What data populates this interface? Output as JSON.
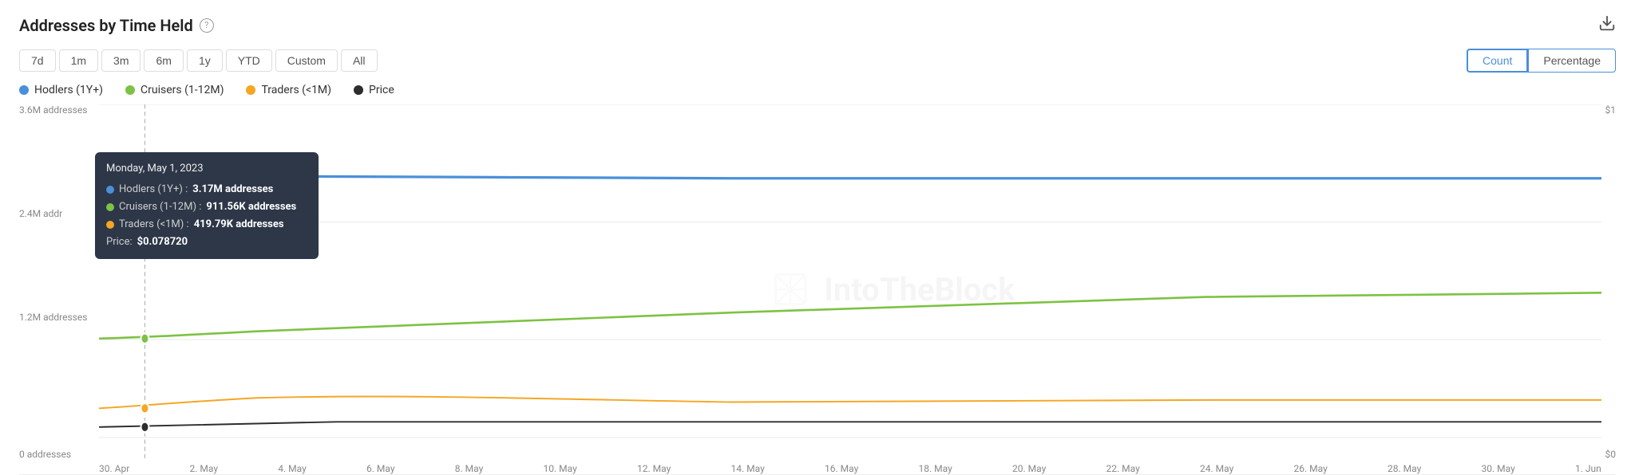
{
  "header": {
    "title": "Addresses by Time Held",
    "help_label": "?",
    "download_label": "⬇"
  },
  "toolbar": {
    "time_buttons": [
      {
        "label": "7d",
        "id": "7d"
      },
      {
        "label": "1m",
        "id": "1m"
      },
      {
        "label": "3m",
        "id": "3m"
      },
      {
        "label": "6m",
        "id": "6m"
      },
      {
        "label": "1y",
        "id": "1y"
      },
      {
        "label": "YTD",
        "id": "ytd"
      },
      {
        "label": "Custom",
        "id": "custom"
      },
      {
        "label": "All",
        "id": "all"
      }
    ],
    "view_buttons": [
      {
        "label": "Count",
        "id": "count",
        "active": true
      },
      {
        "label": "Percentage",
        "id": "percentage",
        "active": false
      }
    ]
  },
  "legend": [
    {
      "label": "Hodlers (1Y+)",
      "color": "#4a90d9"
    },
    {
      "label": "Cruisers (1-12M)",
      "color": "#7dc244"
    },
    {
      "label": "Traders (<1M)",
      "color": "#f5a623"
    },
    {
      "label": "Price",
      "color": "#2d2d2d"
    }
  ],
  "y_axis": {
    "top": "3.6M addresses",
    "mid1": "2.4M addr",
    "mid2": "1.2M addresses",
    "bottom": "0 addresses",
    "right_top": "$1",
    "right_bottom": "$0"
  },
  "x_axis": {
    "labels": [
      "30. Apr",
      "2. May",
      "4. May",
      "6. May",
      "8. May",
      "10. May",
      "12. May",
      "14. May",
      "16. May",
      "18. May",
      "20. May",
      "22. May",
      "24. May",
      "26. May",
      "28. May",
      "30. May",
      "1. Jun"
    ]
  },
  "tooltip": {
    "date": "Monday, May 1, 2023",
    "rows": [
      {
        "label": "Hodlers (1Y+) : ",
        "value": "3.17M addresses",
        "color": "#4a90d9"
      },
      {
        "label": "Cruisers (1-12M) : ",
        "value": "911.56K addresses",
        "color": "#7dc244"
      },
      {
        "label": "Traders (<1M) : ",
        "value": "419.79K addresses",
        "color": "#f5a623"
      },
      {
        "label": "Price: ",
        "value": "$0.078720",
        "color": null
      }
    ]
  },
  "watermark": "IntoTheBlock"
}
